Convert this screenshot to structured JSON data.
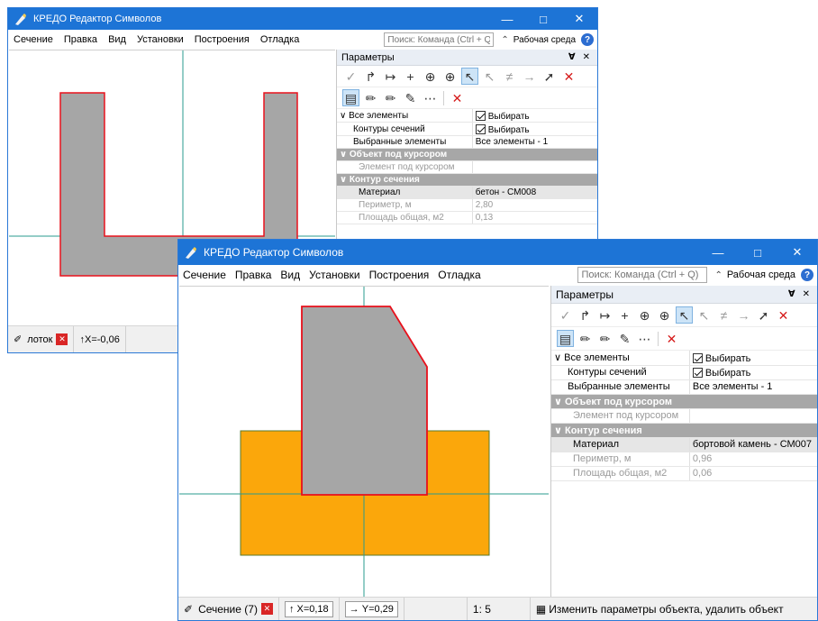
{
  "back_window": {
    "title": "КРЕДО Редактор Символов",
    "menu": [
      "Сечение",
      "Правка",
      "Вид",
      "Установки",
      "Построения",
      "Отладка"
    ],
    "search_placeholder": "Поиск: Команда (Ctrl + Q)",
    "workspace_label": "Рабочая среда",
    "panel_title": "Параметры",
    "props": {
      "all_elements": {
        "label": "Все элементы",
        "value": "Выбирать"
      },
      "section_contours": {
        "label": "Контуры сечений",
        "value": "Выбирать"
      },
      "selected": {
        "label": "Выбранные элементы",
        "value": "Все элементы - 1"
      },
      "group_cursor": "Объект под курсором",
      "element_under_cursor": {
        "label": "Элемент под курсором",
        "value": ""
      },
      "group_contour": "Контур сечения",
      "material": {
        "label": "Материал",
        "value": "бетон - СМ008"
      },
      "perimeter": {
        "label": "Периметр, м",
        "value": "2,80"
      },
      "area": {
        "label": "Площадь общая, м2",
        "value": "0,13"
      }
    },
    "status": {
      "tab_label": "лоток",
      "x_readout": "X=-0,06"
    }
  },
  "front_window": {
    "title": "КРЕДО Редактор Символов",
    "menu": [
      "Сечение",
      "Правка",
      "Вид",
      "Установки",
      "Построения",
      "Отладка"
    ],
    "search_placeholder": "Поиск: Команда (Ctrl + Q)",
    "workspace_label": "Рабочая среда",
    "panel_title": "Параметры",
    "props": {
      "all_elements": {
        "label": "Все элементы",
        "value": "Выбирать"
      },
      "section_contours": {
        "label": "Контуры сечений",
        "value": "Выбирать"
      },
      "selected": {
        "label": "Выбранные элементы",
        "value": "Все элементы - 1"
      },
      "group_cursor": "Объект под курсором",
      "element_under_cursor": {
        "label": "Элемент под курсором",
        "value": ""
      },
      "group_contour": "Контур сечения",
      "material": {
        "label": "Материал",
        "value": "бортовой камень - СМ007"
      },
      "perimeter": {
        "label": "Периметр, м",
        "value": "0,96"
      },
      "area": {
        "label": "Площадь общая, м2",
        "value": "0,06"
      }
    },
    "status": {
      "tab_label": "Сечение (7)",
      "x_readout": "X=0,18",
      "y_readout": "Y=0,29",
      "scale": "1: 5",
      "hint": "Изменить параметры объекта, удалить объект"
    }
  },
  "colors": {
    "titlebar": "#1d74d6",
    "shape_fill": "#a6a6a6",
    "shape_outline": "#e8101b",
    "base_fill": "#fba70b",
    "axis_line": "#2a9b8f",
    "group_header": "#a7a7a7"
  },
  "icons": [
    "app-pen-icon",
    "minimize-icon",
    "maximize-icon",
    "close-icon",
    "workspace-icon",
    "help-icon",
    "pin-icon",
    "select-icon",
    "cursor-icon",
    "crosshair-icon",
    "eraser-icon",
    "delete-icon"
  ]
}
